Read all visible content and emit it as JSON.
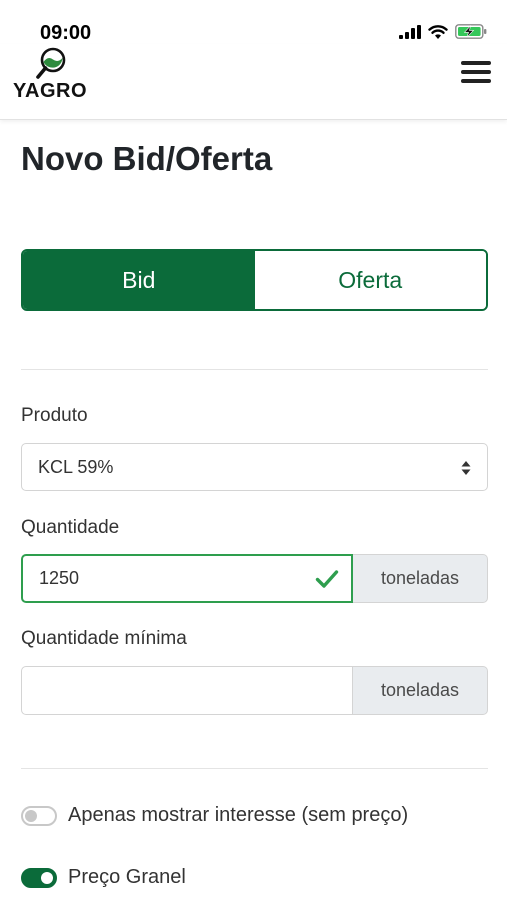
{
  "status_bar": {
    "time": "09:00"
  },
  "header": {
    "logo_text": "YAGRO",
    "menu_icon": "hamburger-menu-icon"
  },
  "page": {
    "title": "Novo Bid/Oferta"
  },
  "type_toggle": {
    "options": [
      {
        "label": "Bid",
        "selected": true
      },
      {
        "label": "Oferta",
        "selected": false
      }
    ]
  },
  "form": {
    "produto": {
      "label": "Produto",
      "value": "KCL 59%"
    },
    "quantidade": {
      "label": "Quantidade",
      "value": "1250",
      "unit": "toneladas",
      "valid": true
    },
    "quantidade_minima": {
      "label": "Quantidade mínima",
      "value": "",
      "unit": "toneladas"
    }
  },
  "toggles": [
    {
      "label": "Apenas mostrar interesse (sem preço)",
      "checked": false
    },
    {
      "label": "Preço Granel",
      "checked": true
    }
  ],
  "colors": {
    "brand_green": "#0b6b3a",
    "valid_green": "#2e9e4e"
  }
}
